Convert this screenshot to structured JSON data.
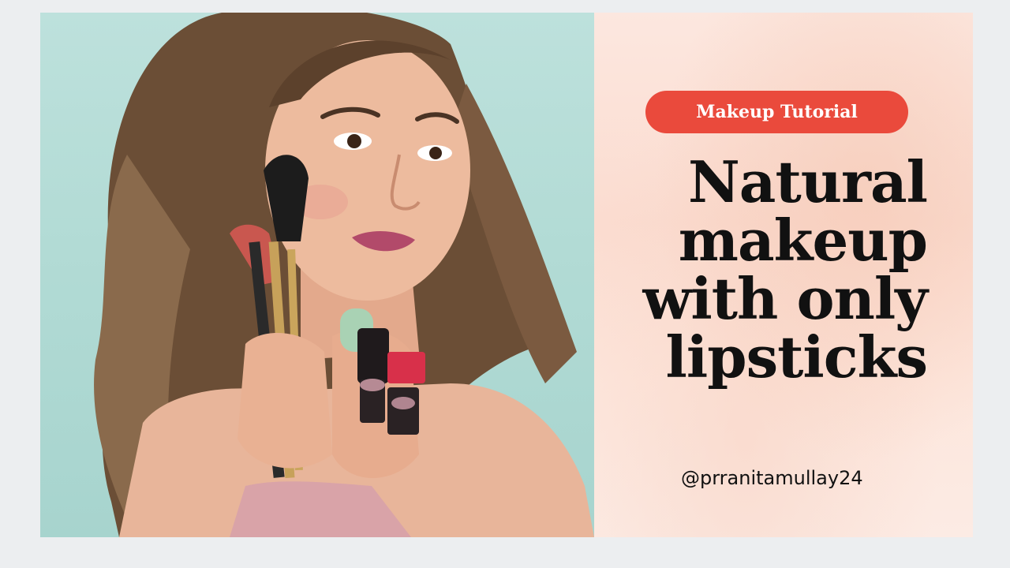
{
  "thumbnail": {
    "badge_label": "Makeup Tutorial",
    "headline_lines": [
      "Natural",
      "makeup",
      "with only",
      "lipsticks"
    ],
    "handle": "@prranitamullay24"
  },
  "colors": {
    "badge": "#ea4a3c",
    "photo_background": "#b2dbd5",
    "panel_background": "#fbdcd0",
    "headline_text": "#111111"
  }
}
